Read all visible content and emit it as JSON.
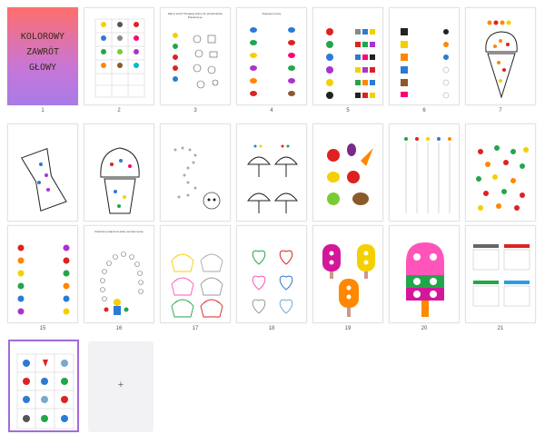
{
  "cover": {
    "title_lines": [
      "KOLOROWY",
      "ZAWRÓT",
      "GŁOWY"
    ]
  },
  "page_numbers": [
    "1",
    "2",
    "3",
    "4",
    "5",
    "6",
    "7",
    "8",
    "9",
    "10",
    "11",
    "12",
    "13",
    "14",
    "15",
    "16",
    "17",
    "18",
    "19",
    "20",
    "21"
  ],
  "captions": {
    "p3": "Jaki to kolor? Dopasuj kolory do przedmiotów. Pokoloruj je.",
    "p4": "Dopasuj w pary",
    "p16": "Pokoloruj połączone koła, tworząc tęczę"
  },
  "add_page": {
    "label": "+"
  },
  "colors": {
    "selected_border": "#a36bd6",
    "cover_top": "#ff6e6b",
    "cover_bottom": "#a87be8"
  }
}
